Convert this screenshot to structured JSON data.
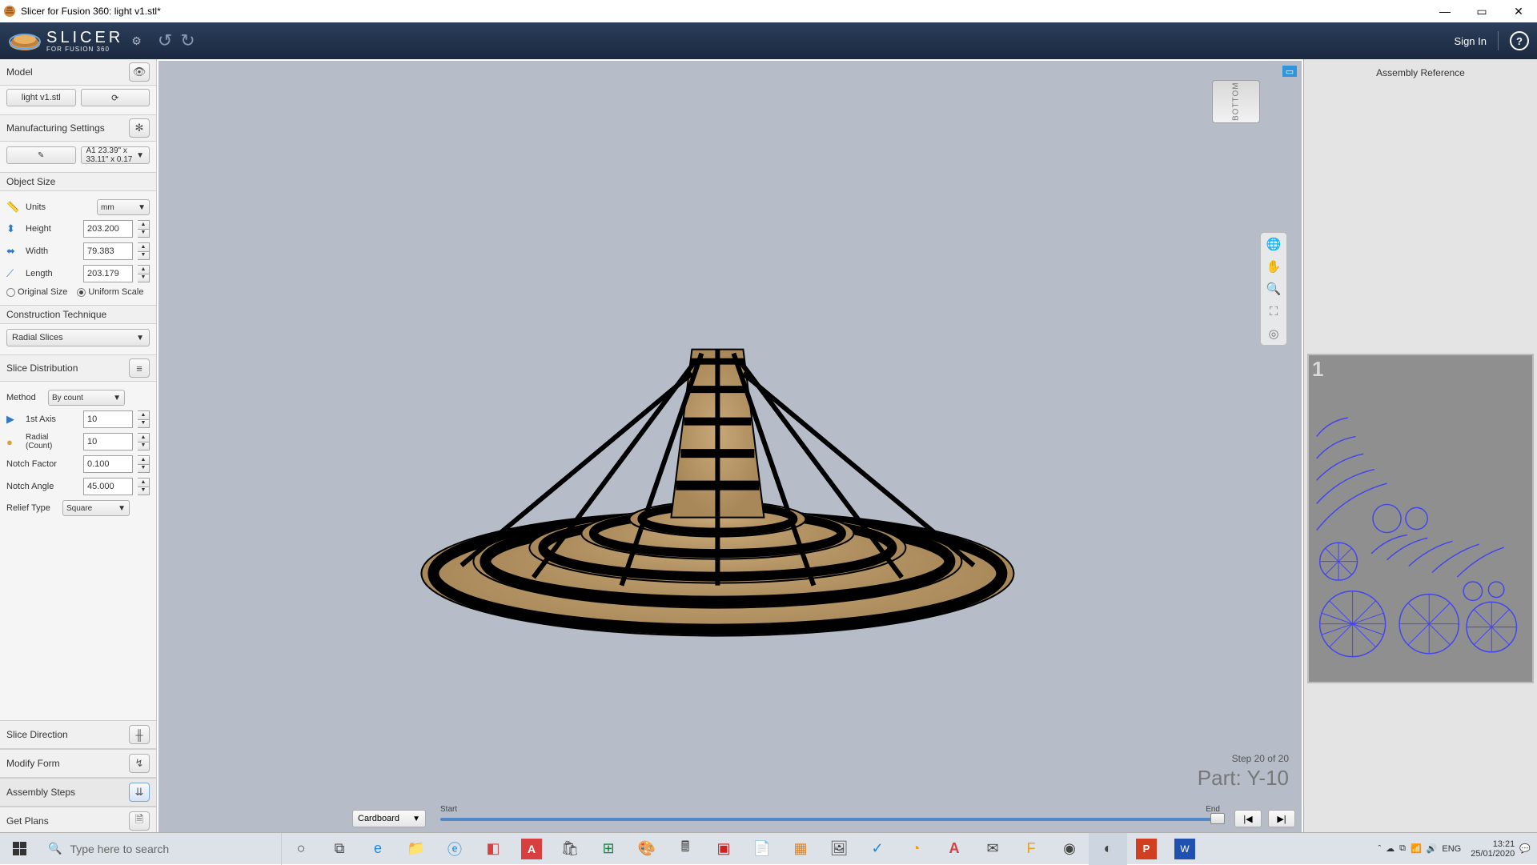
{
  "title": "Slicer for Fusion 360: light v1.stl*",
  "logo": {
    "main": "SLICER",
    "sub": "FOR FUSION 360"
  },
  "signIn": "Sign In",
  "sidebar": {
    "model": {
      "header": "Model",
      "file": "light v1.stl"
    },
    "mfg": {
      "header": "Manufacturing Settings",
      "value": "A1 23.39\" x 33.11\" x 0.17"
    },
    "objSize": {
      "header": "Object Size",
      "units_lbl": "Units",
      "units_val": "mm",
      "height_lbl": "Height",
      "height_val": "203.200",
      "width_lbl": "Width",
      "width_val": "79.383",
      "length_lbl": "Length",
      "length_val": "203.179",
      "orig": "Original Size",
      "uniform": "Uniform Scale"
    },
    "construct": {
      "header": "Construction Technique",
      "val": "Radial Slices"
    },
    "sliceDist": {
      "header": "Slice Distribution",
      "method_lbl": "Method",
      "method_val": "By count",
      "first_lbl": "1st Axis",
      "first_val": "10",
      "radial_lbl": "Radial\n(Count)",
      "radial_val": "10",
      "notchF_lbl": "Notch Factor",
      "notchF_val": "0.100",
      "notchA_lbl": "Notch Angle",
      "notchA_val": "45.000",
      "relief_lbl": "Relief Type",
      "relief_val": "Square"
    },
    "sliceDir": "Slice Direction",
    "modify": "Modify Form",
    "assembly": "Assembly Steps",
    "getPlans": "Get Plans"
  },
  "viewport": {
    "face": "BOTTOM",
    "step": "Step 20 of 20",
    "part": "Part: Y-10",
    "material": "Cardboard",
    "start": "Start",
    "end": "End"
  },
  "right": {
    "title": "Assembly Reference",
    "sheet": "1"
  },
  "taskbar": {
    "search": "Type here to search",
    "lang": "ENG",
    "time": "13:21",
    "date": "25/01/2020"
  }
}
